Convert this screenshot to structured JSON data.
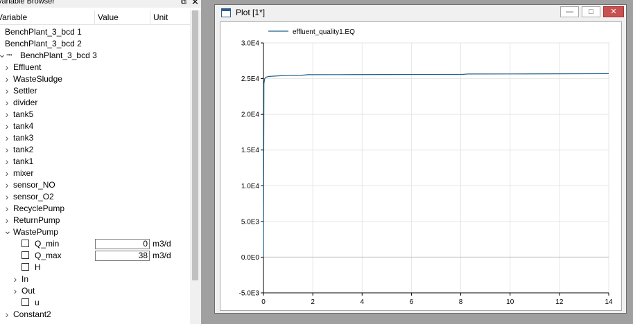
{
  "variable_browser": {
    "title": "Variable Browser",
    "float_icon": "float-icon",
    "close_icon": "close-icon",
    "columns": [
      "Variable",
      "Value",
      "Unit"
    ],
    "rows": [
      {
        "label": "BenchPlant_3_bcd 1",
        "kind": "root"
      },
      {
        "label": "BenchPlant_3_bcd 2",
        "kind": "root"
      },
      {
        "label": "BenchPlant_3_bcd 3",
        "kind": "root-expanded"
      },
      {
        "label": "Effluent",
        "kind": "node"
      },
      {
        "label": "WasteSludge",
        "kind": "node"
      },
      {
        "label": "Settler",
        "kind": "node"
      },
      {
        "label": "divider",
        "kind": "node"
      },
      {
        "label": "tank5",
        "kind": "node"
      },
      {
        "label": "tank4",
        "kind": "node"
      },
      {
        "label": "tank3",
        "kind": "node"
      },
      {
        "label": "tank2",
        "kind": "node"
      },
      {
        "label": "tank1",
        "kind": "node"
      },
      {
        "label": "mixer",
        "kind": "node"
      },
      {
        "label": "sensor_NO",
        "kind": "node"
      },
      {
        "label": "sensor_O2",
        "kind": "node"
      },
      {
        "label": "RecyclePump",
        "kind": "node"
      },
      {
        "label": "ReturnPump",
        "kind": "node"
      },
      {
        "label": "WastePump",
        "kind": "node-expanded"
      },
      {
        "label": "Q_min",
        "kind": "param",
        "value": "0",
        "unit": "m3/d"
      },
      {
        "label": "Q_max",
        "kind": "param",
        "value": "38",
        "unit": "m3/d"
      },
      {
        "label": "H",
        "kind": "var"
      },
      {
        "label": "In",
        "kind": "subnode"
      },
      {
        "label": "Out",
        "kind": "subnode"
      },
      {
        "label": "u",
        "kind": "var"
      },
      {
        "label": "Constant2",
        "kind": "node"
      }
    ]
  },
  "plot_window": {
    "title": "Plot [1*]",
    "buttons": {
      "minimize": "—",
      "maximize": "□",
      "close": "✕"
    }
  },
  "chart_data": {
    "type": "line",
    "title": "",
    "xlabel": "",
    "ylabel": "",
    "xlim": [
      0,
      14
    ],
    "ylim": [
      -5000,
      30000
    ],
    "grid": true,
    "legend_position": "top-left",
    "x_ticks": [
      0,
      2,
      4,
      6,
      8,
      10,
      12,
      14
    ],
    "y_ticks": [
      -5000,
      0,
      5000,
      10000,
      15000,
      20000,
      25000,
      30000
    ],
    "y_tick_labels": [
      "-5.0E3",
      "0.0E0",
      "5.0E3",
      "1.0E4",
      "1.5E4",
      "2.0E4",
      "2.5E4",
      "3.0E4"
    ],
    "series": [
      {
        "name": "effluent_quality1.EQ",
        "color": "#1f5f8b",
        "x": [
          0,
          0.02,
          0.05,
          0.1,
          0.2,
          0.4,
          0.7,
          1.0,
          1.5,
          1.8,
          3,
          5,
          8.1,
          8.3,
          10,
          12,
          14
        ],
        "y": [
          0,
          24300,
          25000,
          25200,
          25300,
          25350,
          25400,
          25420,
          25450,
          25550,
          25560,
          25580,
          25600,
          25650,
          25660,
          25680,
          25700
        ]
      }
    ]
  }
}
